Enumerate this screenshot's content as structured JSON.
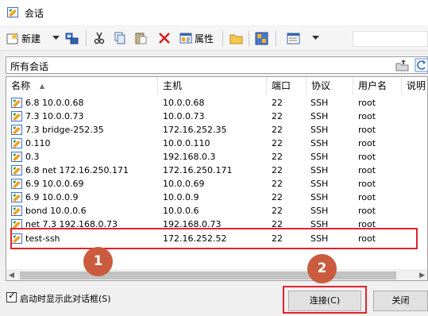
{
  "window": {
    "title": "会话"
  },
  "toolbar": {
    "new_label": "新建",
    "properties_label": "属性",
    "icons": [
      "new-session-icon",
      "dropdown-arrow-icon",
      "connect-transfer-icon",
      "cut-icon",
      "copy-icon",
      "paste-icon",
      "delete-icon",
      "properties-icon",
      "folder-icon",
      "import-export-icon",
      "view-icon",
      "dropdown-arrow-icon"
    ]
  },
  "path": {
    "text": "所有会话"
  },
  "table": {
    "columns": [
      "名称",
      "主机",
      "端口",
      "协议",
      "用户名",
      "说明"
    ],
    "sort_indicator": "▲",
    "rows": [
      {
        "name": "6.8  10.0.0.68",
        "host": "10.0.0.68",
        "port": "22",
        "protocol": "SSH",
        "user": "root"
      },
      {
        "name": "7.3 10.0.0.73",
        "host": "10.0.0.73",
        "port": "22",
        "protocol": "SSH",
        "user": "root"
      },
      {
        "name": "7.3 bridge-252.35",
        "host": "172.16.252.35",
        "port": "22",
        "protocol": "SSH",
        "user": "root"
      },
      {
        "name": "0.110",
        "host": "10.0.0.110",
        "port": "22",
        "protocol": "SSH",
        "user": "root"
      },
      {
        "name": "0.3",
        "host": "192.168.0.3",
        "port": "22",
        "protocol": "SSH",
        "user": "root"
      },
      {
        "name": "6.8 net 172.16.250.171",
        "host": "172.16.250.171",
        "port": "22",
        "protocol": "SSH",
        "user": "root"
      },
      {
        "name": "6.9 10.0.0.69",
        "host": "10.0.0.69",
        "port": "22",
        "protocol": "SSH",
        "user": "root"
      },
      {
        "name": "6.9 10.0.0.9",
        "host": "10.0.0.9",
        "port": "22",
        "protocol": "SSH",
        "user": "root"
      },
      {
        "name": "bond 10.0.0.6",
        "host": "10.0.0.6",
        "port": "22",
        "protocol": "SSH",
        "user": "root"
      },
      {
        "name": "net 7.3 192.168.0.73",
        "host": "192.168.0.73",
        "port": "22",
        "protocol": "SSH",
        "user": "root"
      },
      {
        "name": "test-ssh",
        "host": "172.16.252.52",
        "port": "22",
        "protocol": "SSH",
        "user": "root"
      }
    ]
  },
  "footer": {
    "startup_checkbox_label": "启动时显示此对话框(S)",
    "startup_checked": true,
    "checkbox_mark": "✓",
    "connect_label": "连接(C)",
    "close_label": "关闭"
  },
  "annotations": {
    "badge_1": "1",
    "badge_2": "2",
    "color": "#e0232b",
    "badge_color": "#ca5b3e"
  }
}
